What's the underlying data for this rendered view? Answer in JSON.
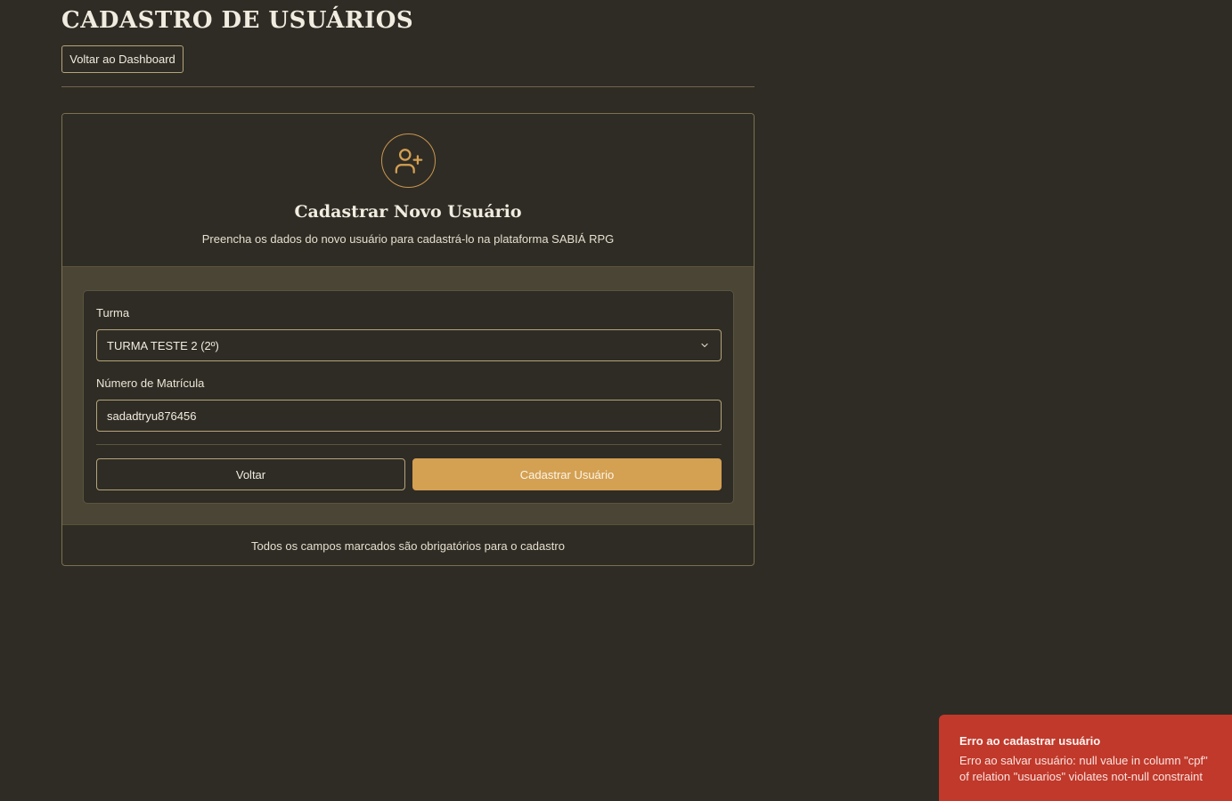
{
  "header": {
    "title": "CADASTRO DE USUÁRIOS",
    "back_dashboard_label": "Voltar ao Dashboard"
  },
  "card": {
    "icon": "user-plus-icon",
    "title": "Cadastrar Novo Usuário",
    "subtitle": "Preencha os dados do novo usuário para cadastrá-lo na plataforma SABIÁ RPG",
    "footer_note": "Todos os campos marcados são obrigatórios para o cadastro"
  },
  "form": {
    "turma_label": "Turma",
    "turma_value": "TURMA TESTE 2 (2º)",
    "matricula_label": "Número de Matrícula",
    "matricula_value": "sadadtryu876456",
    "back_label": "Voltar",
    "submit_label": "Cadastrar Usuário"
  },
  "toast": {
    "title": "Erro ao cadastrar usuário",
    "message": "Erro ao salvar usuário: null value in column \"cpf\" of relation \"usuarios\" violates not-null constraint"
  },
  "colors": {
    "background": "#2f2c25",
    "panel": "#4a4535",
    "accent": "#d4a052",
    "border": "#b5a47a",
    "error": "#c0392b"
  }
}
